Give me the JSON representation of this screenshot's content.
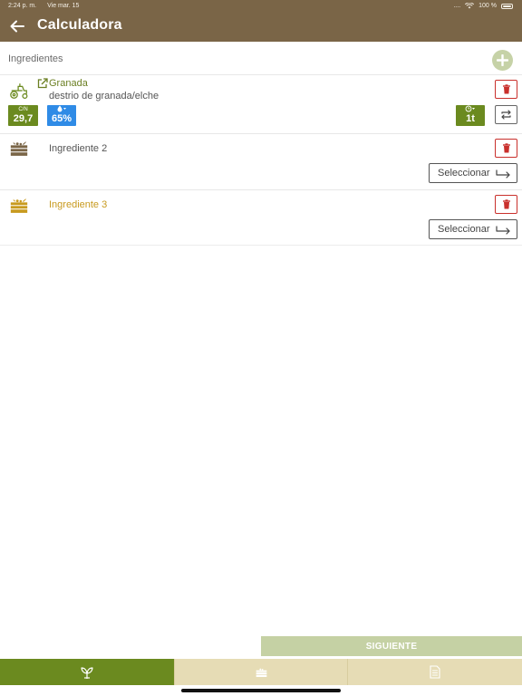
{
  "status_bar": {
    "time": "2:24 p. m.",
    "date": "Vie mar. 15",
    "signal": "....",
    "battery": "100 %"
  },
  "nav": {
    "title": "Calculadora",
    "back_icon": "arrow-left-icon",
    "bar_color": "#7a6547"
  },
  "section": {
    "label": "Ingredientes",
    "add_icon": "plus-icon"
  },
  "ingredients": [
    {
      "name": "Granada",
      "subtitle": "destrio de granada/elche",
      "icon": "tractor-icon",
      "cn_label": "C/N",
      "cn_value": "29,7",
      "humidity_value": "65%",
      "quantity_value": "1t",
      "color": "#6b7f22"
    },
    {
      "name": "Ingrediente 2",
      "icon": "crate-icon",
      "select_label": "Seleccionar",
      "color": "#7a6547"
    },
    {
      "name": "Ingrediente 3",
      "icon": "crate-icon",
      "select_label": "Seleccionar",
      "color": "#c89a1e"
    }
  ],
  "footer": {
    "next_label": "SIGUIENTE",
    "tabs": [
      {
        "icon": "plant-leaves-icon",
        "active": true
      },
      {
        "icon": "crate-icon",
        "active": false
      },
      {
        "icon": "document-icon",
        "active": false
      }
    ],
    "accent_color": "#6b8a1f"
  }
}
